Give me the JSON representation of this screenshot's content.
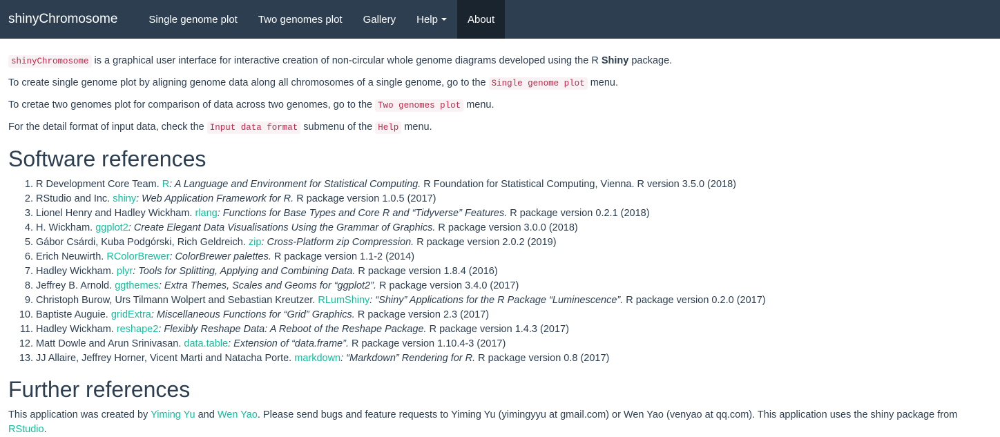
{
  "navbar": {
    "brand": "shinyChromosome",
    "items": [
      "Single genome plot",
      "Two genomes plot",
      "Gallery",
      "Help",
      "About"
    ]
  },
  "intro": {
    "p1": {
      "code": "shinyChromosome",
      "text": " is a graphical user interface for interactive creation of non-circular whole genome diagrams developed using the R ",
      "bold": "Shiny",
      "end": " package."
    },
    "p2": {
      "text": "To create single genome plot by aligning genome data along all chromosomes of a single genome, go to the ",
      "code": "Single genome plot",
      "end": " menu."
    },
    "p3": {
      "text": "To cretae two genomes plot for comparison of data across two genomes, go to the ",
      "code": "Two genomes plot",
      "end": " menu."
    },
    "p4": {
      "text": "For the detail format of input data, check the ",
      "code": "Input data format",
      "mid": " submenu of the ",
      "code2": "Help",
      "end": " menu."
    }
  },
  "software": {
    "heading": "Software references",
    "refs": [
      {
        "authors": "R Development Core Team. ",
        "link": "R",
        "title": ": A Language and Environment for Statistical Computing.",
        "rest": " R Foundation for Statistical Computing, Vienna. R version 3.5.0 (2018)"
      },
      {
        "authors": "RStudio and Inc. ",
        "link": "shiny",
        "title": ": Web Application Framework for R.",
        "rest": " R package version 1.0.5 (2017)"
      },
      {
        "authors": "Lionel Henry and Hadley Wickham. ",
        "link": "rlang",
        "title": ": Functions for Base Types and Core R and “Tidyverse” Features.",
        "rest": " R package version 0.2.1 (2018)"
      },
      {
        "authors": "H. Wickham. ",
        "link": "ggplot2",
        "title": ": Create Elegant Data Visualisations Using the Grammar of Graphics.",
        "rest": " R package version 3.0.0 (2018)"
      },
      {
        "authors": "Gábor Csárdi, Kuba Podgórski, Rich Geldreich. ",
        "link": "zip",
        "title": ": Cross-Platform zip Compression.",
        "rest": " R package version 2.0.2 (2019)"
      },
      {
        "authors": "Erich Neuwirth. ",
        "link": "RColorBrewer",
        "title": ": ColorBrewer palettes.",
        "rest": " R package version 1.1-2 (2014)"
      },
      {
        "authors": "Hadley Wickham. ",
        "link": "plyr",
        "title": ": Tools for Splitting, Applying and Combining Data.",
        "rest": " R package version 1.8.4 (2016)"
      },
      {
        "authors": "Jeffrey B. Arnold. ",
        "link": "ggthemes",
        "title": ": Extra Themes, Scales and Geoms for “ggplot2”.",
        "rest": " R package version 3.4.0 (2017)"
      },
      {
        "authors": "Christoph Burow, Urs Tilmann Wolpert and Sebastian Kreutzer. ",
        "link": "RLumShiny",
        "title": ": “Shiny” Applications for the R Package “Luminescence”.",
        "rest": " R package version 0.2.0 (2017)"
      },
      {
        "authors": "Baptiste Auguie. ",
        "link": "gridExtra",
        "title": ": Miscellaneous Functions for “Grid” Graphics.",
        "rest": " R package version 2.3 (2017)"
      },
      {
        "authors": "Hadley Wickham. ",
        "link": "reshape2",
        "title": ": Flexibly Reshape Data: A Reboot of the Reshape Package.",
        "rest": " R package version 1.4.3 (2017)"
      },
      {
        "authors": "Matt Dowle and Arun Srinivasan. ",
        "link": "data.table",
        "title": ": Extension of “data.frame”.",
        "rest": " R package version 1.10.4-3 (2017)"
      },
      {
        "authors": "JJ Allaire, Jeffrey Horner, Vicent Marti and Natacha Porte. ",
        "link": "markdown",
        "title": ": “Markdown” Rendering for R.",
        "rest": " R package version 0.8 (2017)"
      }
    ]
  },
  "further": {
    "heading": "Further references",
    "t1": "This application was created by ",
    "link1": "Yiming Yu",
    "t2": " and ",
    "link2": "Wen Yao",
    "t3": ". Please send bugs and feature requests to Yiming Yu (yimingyyu at gmail.com) or Wen Yao (venyao at qq.com). This application uses the shiny package from ",
    "link3": "RStudio",
    "t4": "."
  }
}
